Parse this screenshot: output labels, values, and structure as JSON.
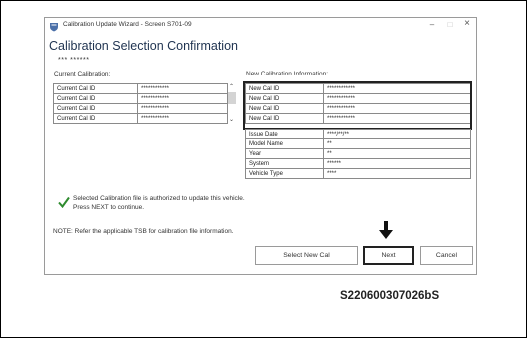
{
  "window": {
    "title": "Calibration Update Wizard - Screen S701-09",
    "heading": "Calibration Selection Confirmation",
    "masked_title": "*** ******",
    "controls": [
      "–",
      "□",
      "×"
    ]
  },
  "current": {
    "label": "Current Calibration:",
    "rows": [
      {
        "label": "Current Cal ID",
        "value": "************"
      },
      {
        "label": "Current Cal ID",
        "value": "************"
      },
      {
        "label": "Current Cal ID",
        "value": "************"
      },
      {
        "label": "Current Cal ID",
        "value": "************"
      }
    ]
  },
  "new_cal": {
    "label": "New Calibration Information:",
    "id_rows": [
      {
        "label": "New Cal ID",
        "value": "************"
      },
      {
        "label": "New Cal ID",
        "value": "************"
      },
      {
        "label": "New Cal ID",
        "value": "************"
      },
      {
        "label": "New Cal ID",
        "value": "************"
      }
    ],
    "info_rows": [
      {
        "label": "Issue Date",
        "value": "****/**/**"
      },
      {
        "label": "Model Name",
        "value": "**"
      },
      {
        "label": "Year",
        "value": "**"
      },
      {
        "label": "System",
        "value": "******"
      },
      {
        "label": "Vehicle Type",
        "value": "****"
      }
    ]
  },
  "message": {
    "line1": "Selected Calibration file is authorized to update this vehicle.",
    "line2": "Press NEXT to continue."
  },
  "note": "NOTE: Refer the applicable TSB for calibration file information.",
  "buttons": {
    "select": "Select New Cal",
    "next": "Next",
    "cancel": "Cancel"
  },
  "reference": "S220600307026bS",
  "colors": {
    "check": "#2e8b2e",
    "heading": "#1f3350",
    "highlight_border": "#222222"
  },
  "icons": {
    "app": "shield-icon",
    "check": "checkmark-icon",
    "pointer": "down-arrow-icon"
  }
}
